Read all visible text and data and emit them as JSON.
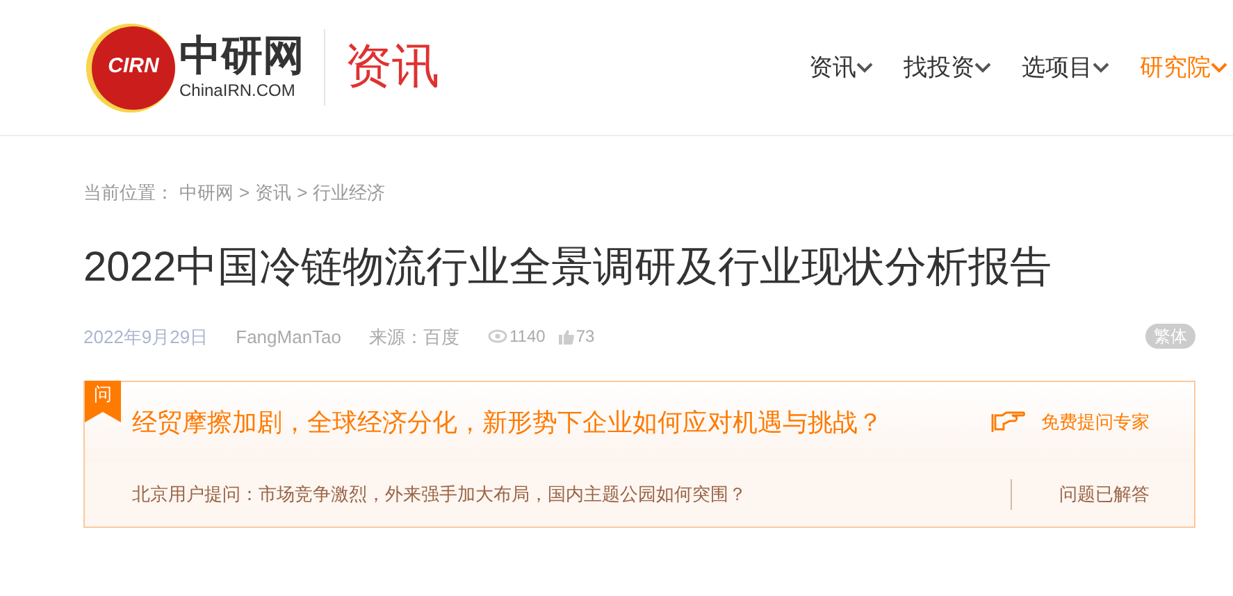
{
  "logo": {
    "badge": "CIRN",
    "name": "中研网",
    "domain": "ChinaIRN.COM",
    "section": "资讯"
  },
  "nav": [
    {
      "label": "资讯",
      "selected": false
    },
    {
      "label": "找投资",
      "selected": false
    },
    {
      "label": "选项目",
      "selected": false
    },
    {
      "label": "研究院",
      "selected": true
    }
  ],
  "breadcrumb": {
    "prefix": "当前位置：",
    "items": [
      "中研网",
      "资讯",
      "行业经济"
    ],
    "separator": ">"
  },
  "article": {
    "title": "2022中国冷链物流行业全景调研及行业现状分析报告",
    "date": "2022年9月29日",
    "author": "FangManTao",
    "source": "来源：百度",
    "views": "1140",
    "likes": "73",
    "script_toggle": "繁体"
  },
  "question_box": {
    "tag": "问",
    "question": "经贸摩擦加剧，全球经济分化，新形势下企业如何应对机遇与挑战？",
    "ask_link": "免费提问专家",
    "user_question": "北京用户提问：市场竞争激烈，外来强手加大布局，国内主题公园如何突围？",
    "status": "问题已解答"
  }
}
